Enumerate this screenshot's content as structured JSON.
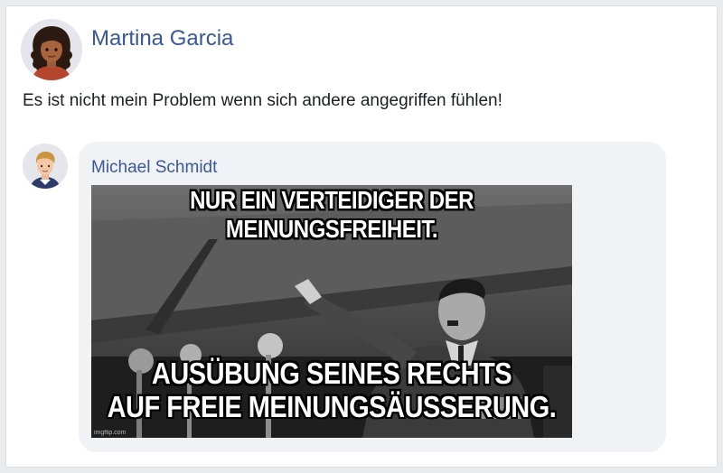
{
  "post": {
    "author": "Martina Garcia",
    "text": "Es ist nicht mein Problem wenn sich andere angegriffen fühlen!"
  },
  "comment": {
    "author": "Michael Schmidt",
    "meme": {
      "top_text": "NUR EIN VERTEIDIGER DER MEINUNGSFREIHEIT.",
      "bottom_line1": "AUSÜBUNG SEINES RECHTS",
      "bottom_line2": "AUF FREIE MEINUNGSÄUSSERUNG.",
      "watermark": "imgflip.com"
    }
  },
  "colors": {
    "name_link": "#385898",
    "bubble": "#f0f2f5"
  },
  "icons": {
    "post_avatar": "avatar-woman-curly-hair",
    "comment_avatar": "avatar-man-blond"
  }
}
